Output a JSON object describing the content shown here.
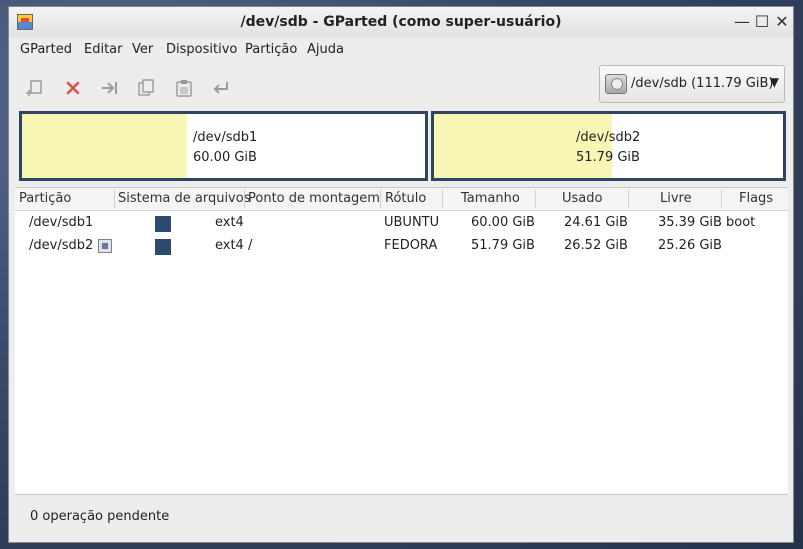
{
  "window": {
    "title": "/dev/sdb - GParted (como super-usuário)"
  },
  "title_buttons": {
    "minimize": "—",
    "maximize": "☐",
    "close": "✕"
  },
  "menu": [
    "GParted",
    "Editar",
    "Ver",
    "Dispositivo",
    "Partição",
    "Ajuda"
  ],
  "toolbar": {
    "icons": [
      "new-partition-icon",
      "delete-icon",
      "resize-move-icon",
      "copy-icon",
      "paste-icon",
      "undo-icon"
    ]
  },
  "device": {
    "label": "/dev/sdb (111.79 GiB)"
  },
  "colors": {
    "partition_frame": "#2e4560",
    "used_fill": "#f8f6b4",
    "ext4": "#2c4a6e"
  },
  "partition_map": [
    {
      "name": "/dev/sdb1",
      "size": "60.00 GiB",
      "used_fraction": 0.41
    },
    {
      "name": "/dev/sdb2",
      "size": "51.79 GiB",
      "used_fraction": 0.51
    }
  ],
  "table": {
    "headers": [
      "Partição",
      "Sistema de arquivos",
      "Ponto de montagem",
      "Rótulo",
      "Tamanho",
      "Usado",
      "Livre",
      "Flags"
    ],
    "rows": [
      {
        "partition": "/dev/sdb1",
        "locked": false,
        "fs": "ext4",
        "mount": "",
        "label": "UBUNTU",
        "size": "60.00 GiB",
        "used": "24.61 GiB",
        "free": "35.39 GiB",
        "flags": "boot"
      },
      {
        "partition": "/dev/sdb2",
        "locked": true,
        "fs": "ext4",
        "mount": "/",
        "label": "FEDORA",
        "size": "51.79 GiB",
        "used": "26.52 GiB",
        "free": "25.26 GiB",
        "flags": ""
      }
    ]
  },
  "status": {
    "text": "0 operação pendente"
  }
}
